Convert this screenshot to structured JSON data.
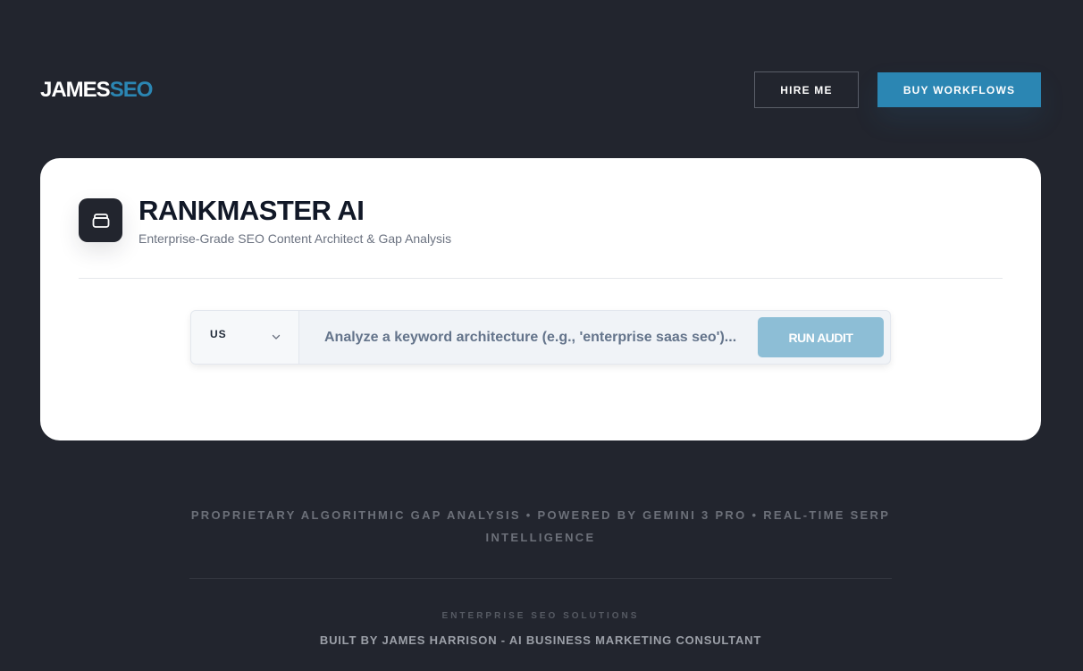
{
  "header": {
    "logo_part1": "JAMES",
    "logo_part2": "SEO",
    "hire_label": "HIRE ME",
    "buy_label": "BUY WORKFLOWS"
  },
  "tool": {
    "icon": "archive-box-icon",
    "title": "RANKMASTER AI",
    "subtitle": "Enterprise-Grade SEO Content Architect & Gap Analysis"
  },
  "search": {
    "country": "US",
    "placeholder": "Analyze a keyword architecture (e.g., 'enterprise saas seo')...",
    "value": "",
    "run_label": "RUN AUDIT"
  },
  "footer": {
    "tagline": "PROPRIETARY ALGORITHMIC GAP ANALYSIS • POWERED BY GEMINI 3 PRO • REAL-TIME SERP INTELLIGENCE",
    "section_label": "ENTERPRISE SEO SOLUTIONS",
    "credit": "BUILT BY JAMES HARRISON - AI BUSINESS MARKETING CONSULTANT"
  },
  "colors": {
    "background": "#22252e",
    "accent": "#2b86b3",
    "run_button": "#8dbed6",
    "card": "#ffffff"
  }
}
